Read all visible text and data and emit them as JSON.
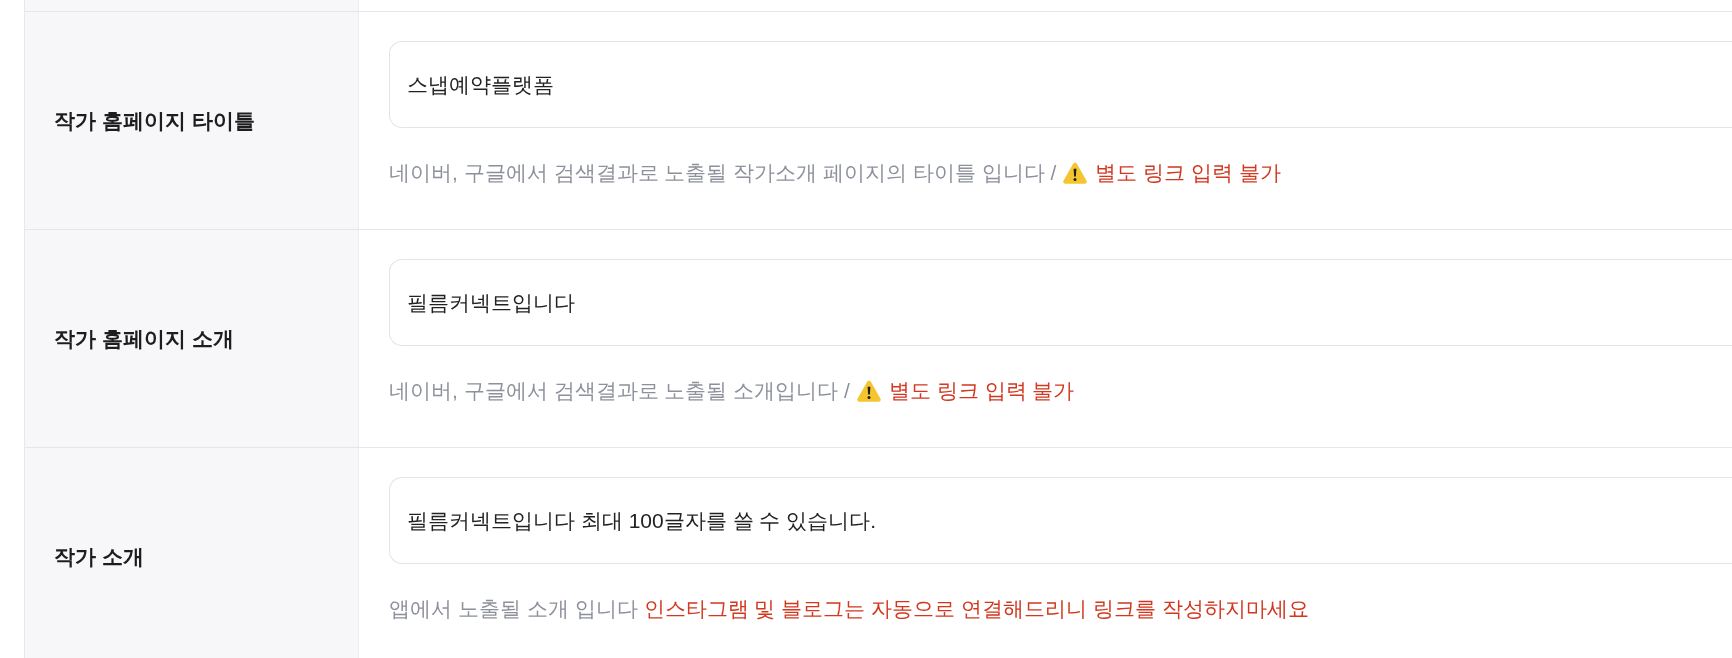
{
  "rows": [
    {
      "label": "작가 홈페이지 타이틀",
      "value": "스냅예약플랫폼",
      "hint": "네이버, 구글에서 검색결과로 노출될 작가소개 페이지의 타이틀 입니다 /",
      "warning_icon": true,
      "warning": "별도 링크 입력 불가"
    },
    {
      "label": "작가 홈페이지 소개",
      "value": "필름커넥트입니다",
      "hint": "네이버, 구글에서 검색결과로 노출될 소개입니다 /",
      "warning_icon": true,
      "warning": "별도 링크 입력 불가"
    },
    {
      "label": "작가 소개",
      "value": "필름커넥트입니다 최대 100글자를 쓸 수 있습니다.",
      "hint": "앱에서 노출될 소개 입니다",
      "warning_icon": false,
      "warning": "인스타그램 및 블로그는 자동으로 연결해드리니 링크를 작성하지마세요"
    }
  ]
}
